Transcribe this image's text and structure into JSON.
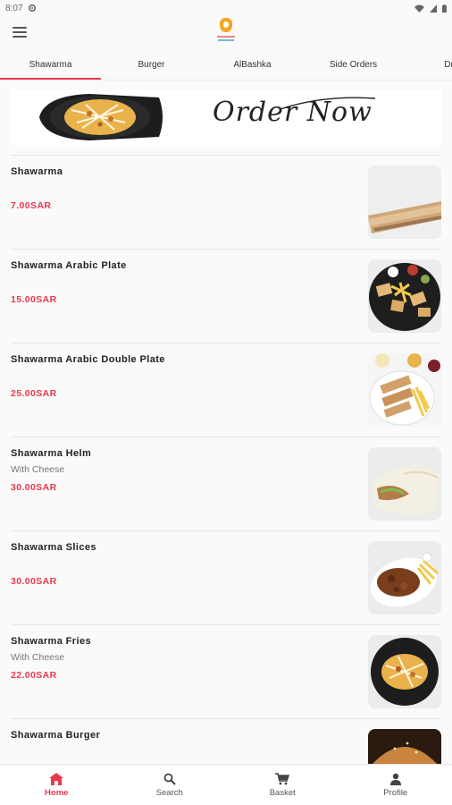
{
  "status_bar": {
    "time": "8:07"
  },
  "tabs": [
    {
      "label": "Shawarma"
    },
    {
      "label": "Burger"
    },
    {
      "label": "AlBashka"
    },
    {
      "label": "Side Orders"
    },
    {
      "label": "Dri"
    }
  ],
  "banner": {
    "text": "Order Now"
  },
  "items": [
    {
      "name": "Shawarma",
      "desc": "",
      "price": "7.00SAR",
      "thumb": "shawarma-wrap"
    },
    {
      "name": "Shawarma Arabic Plate",
      "desc": "",
      "price": "15.00SAR",
      "thumb": "arabic-plate"
    },
    {
      "name": "Shawarma Arabic Double Plate",
      "desc": "",
      "price": "25.00SAR",
      "thumb": "double-plate"
    },
    {
      "name": "Shawarma Helm",
      "desc": "With Cheese",
      "price": "30.00SAR",
      "thumb": "helm-wrap"
    },
    {
      "name": "Shawarma Slices",
      "desc": "",
      "price": "30.00SAR",
      "thumb": "slices"
    },
    {
      "name": "Shawarma Fries",
      "desc": "With Cheese",
      "price": "22.00SAR",
      "thumb": "fries"
    },
    {
      "name": "Shawarma Burger",
      "desc": "",
      "price": "",
      "thumb": "burger"
    }
  ],
  "bottom_nav": [
    {
      "label": "Home",
      "icon": "home-icon"
    },
    {
      "label": "Search",
      "icon": "search-icon"
    },
    {
      "label": "Basket",
      "icon": "cart-icon"
    },
    {
      "label": "Profile",
      "icon": "profile-icon"
    }
  ],
  "colors": {
    "accent": "#e8384f"
  }
}
